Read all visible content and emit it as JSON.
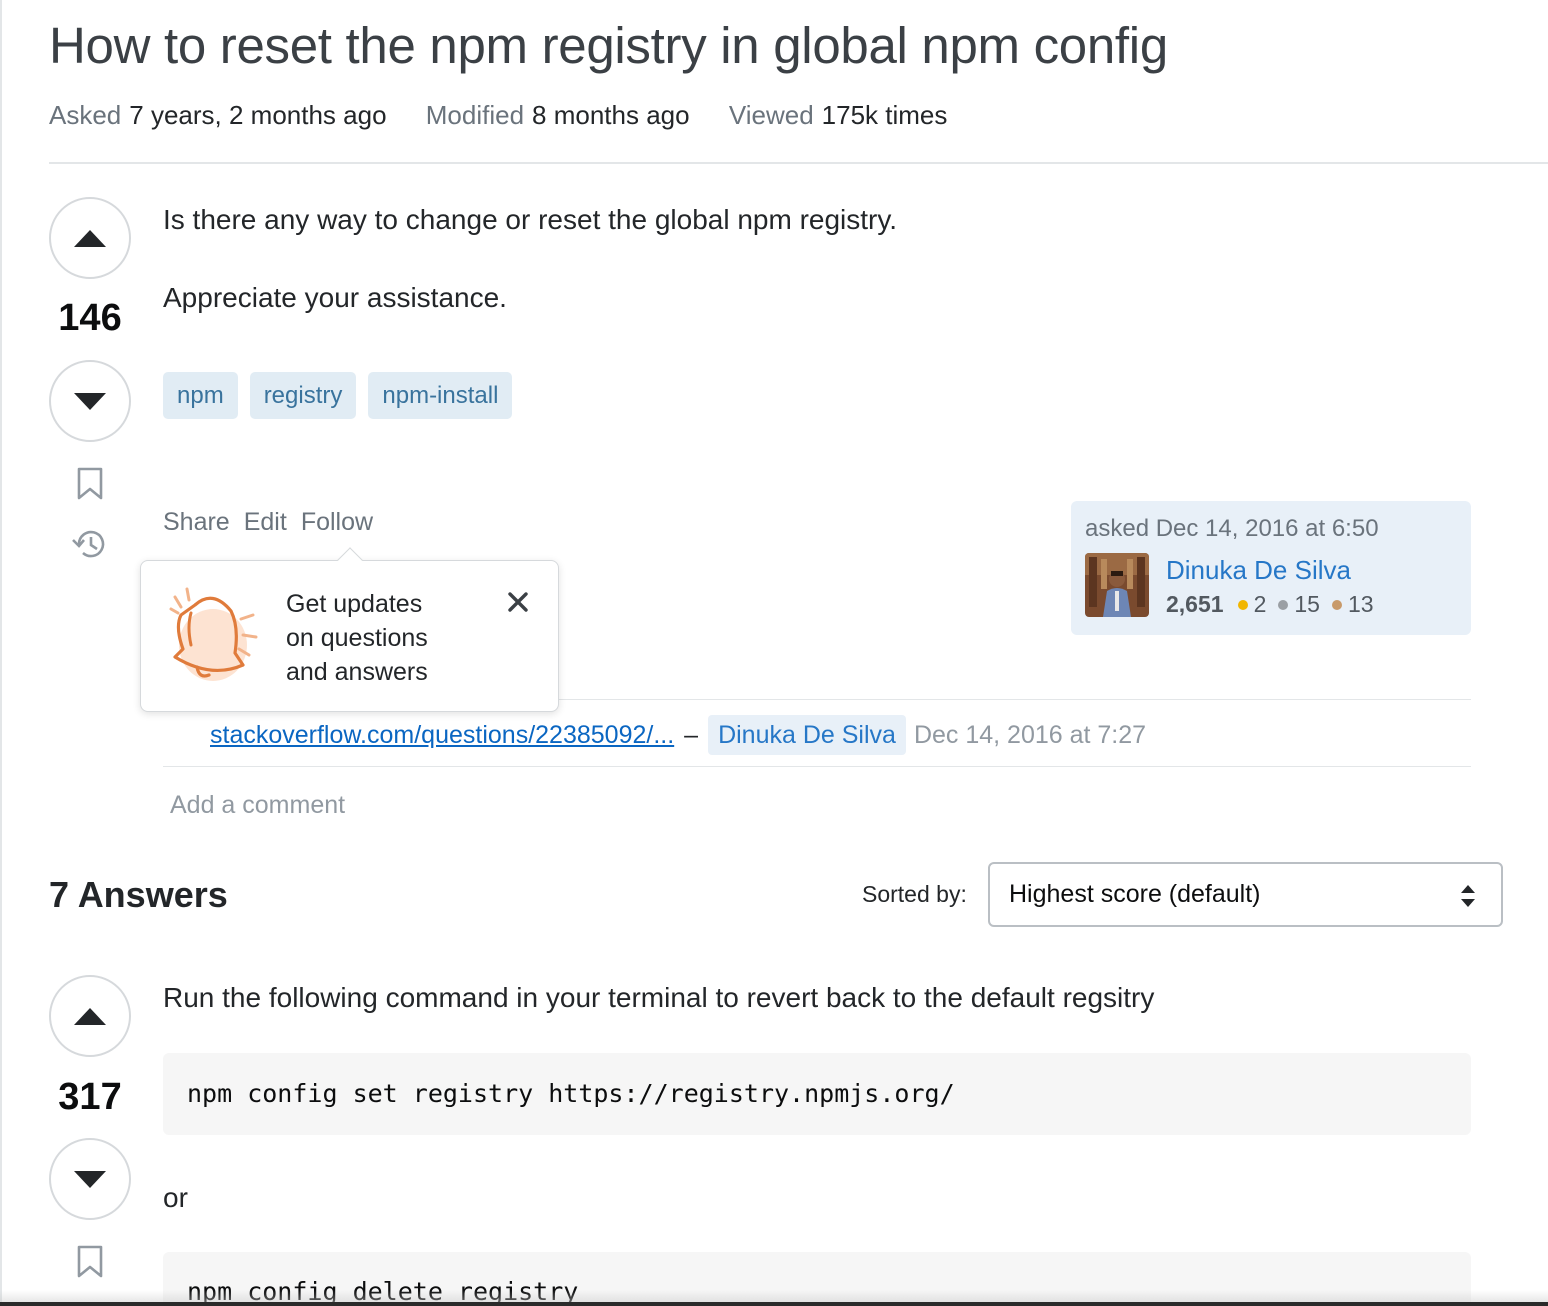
{
  "question": {
    "title": "How to reset the npm registry in global npm config",
    "meta": {
      "asked_label": "Asked",
      "asked_value": "7 years, 2 months ago",
      "modified_label": "Modified",
      "modified_value": "8 months ago",
      "viewed_label": "Viewed",
      "viewed_value": "175k times"
    },
    "score": "146",
    "body_line1": "Is there any way to change or reset the global npm registry.",
    "body_line2": "Appreciate your assistance.",
    "tags": [
      "npm",
      "registry",
      "npm-install"
    ],
    "menu": {
      "share": "Share",
      "edit": "Edit",
      "follow": "Follow"
    },
    "user_card": {
      "asked_text": "asked Dec 14, 2016 at 6:50",
      "name": "Dinuka De Silva",
      "reputation": "2,651",
      "gold": "2",
      "silver": "15",
      "bronze": "13",
      "gold_color": "#f1b600",
      "silver_color": "#9a9fa4",
      "bronze_color": "#c89a6a"
    }
  },
  "follow_popover": {
    "line1": "Get updates",
    "line2": "on questions",
    "line3": "and answers",
    "icon": "bell-icon"
  },
  "comment": {
    "link": "stackoverflow.com/questions/22385092/...",
    "dash": "–",
    "user": "Dinuka De Silva",
    "date": "Dec 14, 2016 at 7:27"
  },
  "add_comment": "Add a comment",
  "answers": {
    "heading": "7 Answers",
    "sorted_label": "Sorted by:",
    "sort_selected": "Highest score (default)",
    "first": {
      "score": "317",
      "text": "Run the following command in your terminal to revert back to the default regsitry",
      "code1": "npm config set registry https://registry.npmjs.org/",
      "or": "or",
      "code2": "npm config delete registry"
    }
  },
  "colors": {
    "link": "#2677c7",
    "tag_bg": "#e1ecf4",
    "tag_fg": "#39739d",
    "bell": "#e07b3b"
  }
}
